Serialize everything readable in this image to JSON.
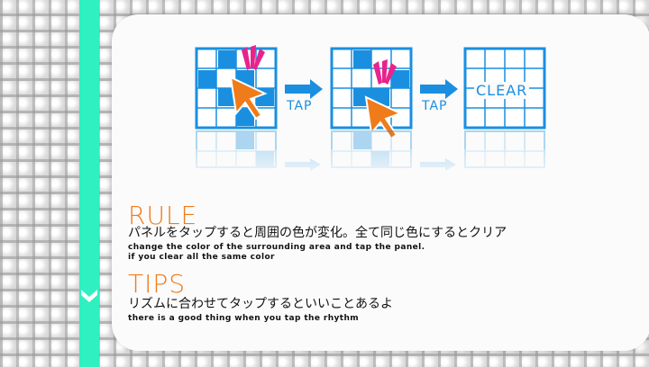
{
  "tutorial": {
    "arrow1_label": "TAP",
    "arrow2_label": "TAP",
    "clear_label": "CLEAR"
  },
  "rule": {
    "title": "RULE",
    "text_jp": "パネルをタップすると周囲の色が変化。全て同じ色にするとクリア",
    "text_en_line1": "change the color of the surrounding area and tap the panel.",
    "text_en_line2": "if you clear all the same color"
  },
  "tips": {
    "title": "TIPS",
    "text_jp": "リズムに合わせてタップするといいことあるよ",
    "text_en": "there is a good thing when you tap the rhythm"
  },
  "colors": {
    "accent_stripe": "#2ef0c0",
    "tile_blue": "#1a8fe0",
    "title_orange": "#f07b1a",
    "tap_pink": "#e8238c",
    "cursor_orange": "#f07b1a"
  }
}
